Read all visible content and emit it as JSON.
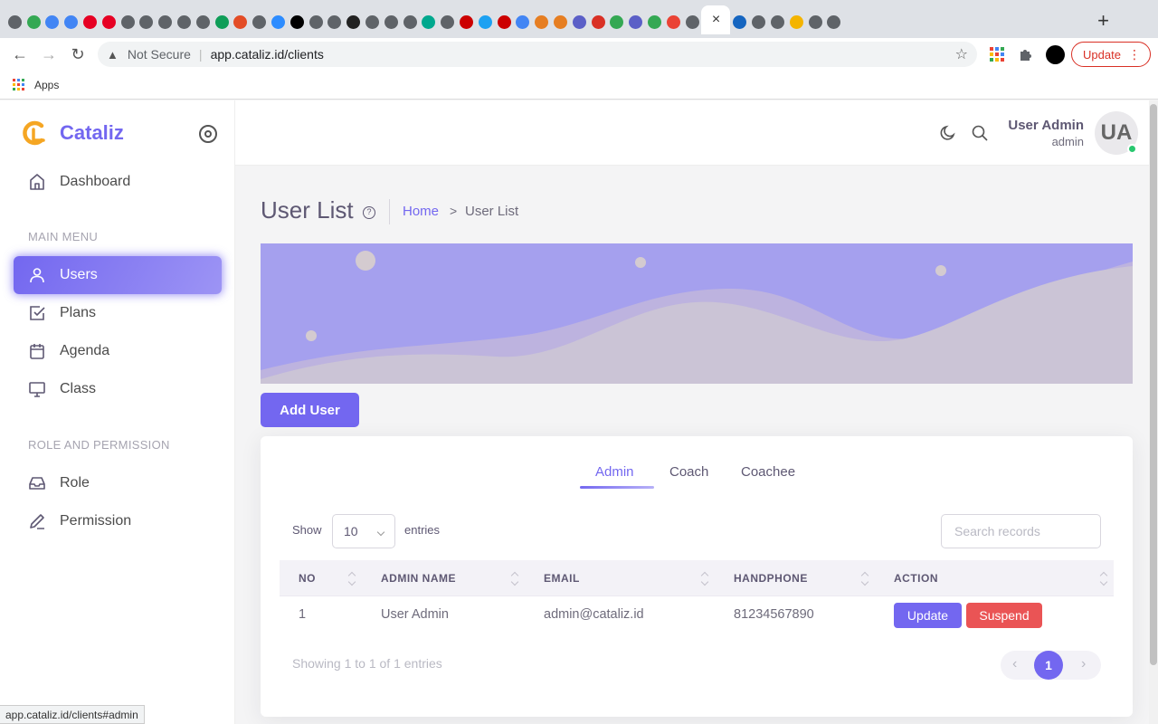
{
  "browser": {
    "not_secure": "Not Secure",
    "url": "app.cataliz.id/clients",
    "update_label": "Update",
    "bookmark_apps": "Apps",
    "status_url": "app.cataliz.id/clients#admin",
    "tab_colors": [
      "#5f6368",
      "#34a853",
      "#4285f4",
      "#4285f4",
      "#e60023",
      "#e60023",
      "#5f6368",
      "#5f6368",
      "#5f6368",
      "#5f6368",
      "#5f6368",
      "#0f9d58",
      "#e34c26",
      "#5f6368",
      "#2d8cff",
      "#000000",
      "#5f6368",
      "#5f6368",
      "#222222",
      "#5f6368",
      "#5f6368",
      "#5f6368",
      "#00a88e",
      "#5f6368",
      "#cc0000",
      "#1da1f2",
      "#cc0000",
      "#4285f4",
      "#e67e22",
      "#e67e22",
      "#5b5fc7",
      "#d93025",
      "#34a853",
      "#5b5fc7",
      "#34a853",
      "#ea4335",
      "#5f6368",
      "#1565c0",
      "#5f6368",
      "#5f6368",
      "#f4b400",
      "#5f6368",
      "#5f6368"
    ]
  },
  "brand": {
    "name": "Cataliz",
    "color": "#7367f0",
    "logo_color": "#f5a623"
  },
  "sidebar": {
    "dashboard": "Dashboard",
    "main_menu_label": "MAIN MENU",
    "main_items": [
      {
        "label": "Users",
        "icon": "user-icon",
        "active": true
      },
      {
        "label": "Plans",
        "icon": "checkbox-icon"
      },
      {
        "label": "Agenda",
        "icon": "calendar-icon"
      },
      {
        "label": "Class",
        "icon": "monitor-icon"
      }
    ],
    "role_section_label": "ROLE AND PERMISSION",
    "role_items": [
      {
        "label": "Role",
        "icon": "inbox-icon"
      },
      {
        "label": "Permission",
        "icon": "pen-icon"
      }
    ]
  },
  "header": {
    "user_name": "User Admin",
    "user_role": "admin",
    "avatar_initials": "UA"
  },
  "page": {
    "title": "User List",
    "breadcrumb_home": "Home",
    "breadcrumb_sep": ">",
    "breadcrumb_current": "User List",
    "add_user": "Add User"
  },
  "tabs": [
    {
      "label": "Admin",
      "active": true
    },
    {
      "label": "Coach"
    },
    {
      "label": "Coachee"
    }
  ],
  "table": {
    "show_label": "Show",
    "entries_value": "10",
    "entries_label": "entries",
    "search_placeholder": "Search records",
    "columns": [
      "NO",
      "ADMIN NAME",
      "EMAIL",
      "HANDPHONE",
      "ACTION"
    ],
    "rows": [
      {
        "no": "1",
        "name": "User Admin",
        "email": "admin@cataliz.id",
        "phone": "81234567890"
      }
    ],
    "update_label": "Update",
    "suspend_label": "Suspend",
    "showing_text": "Showing 1 to 1 of 1 entries",
    "current_page": "1"
  }
}
